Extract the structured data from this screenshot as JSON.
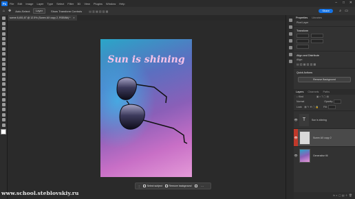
{
  "app": {
    "menu": [
      "File",
      "Edit",
      "Image",
      "Layer",
      "Type",
      "Select",
      "Filter",
      "3D",
      "View",
      "Plugins",
      "Window",
      "Help"
    ],
    "window_controls": [
      "–",
      "□",
      "✕"
    ]
  },
  "options_bar": {
    "auto_select": "Auto-Select:",
    "layer": "Layer",
    "show_transform": "Show Transform Controls",
    "share": "Share"
  },
  "document_tab": {
    "label": "scene 8,451,67 @ 12.5% (Sunex AX copy 2, RGB/8#) *",
    "close": "×"
  },
  "canvas": {
    "headline": "Sun is shining",
    "colors": {
      "top": "#2aa6c8",
      "mid": "#8a5fb8",
      "bottom": "#e49ad8",
      "headline": "#f6c3e8"
    }
  },
  "taskbar": {
    "select_subject": "Select subject",
    "remove_background": "Remove background"
  },
  "watermark": "www.school.steblovskiy.ru",
  "properties_panel": {
    "tabs": [
      "Properties",
      "Libraries"
    ],
    "pixel_layer": "Pixel Layer",
    "transform_title": "Transform",
    "align_title": "Align and Distribute",
    "align_sub": "Align:",
    "quick_actions_title": "Quick Actions",
    "remove_bg_button": "Remove Background"
  },
  "layers_panel": {
    "tabs": [
      "Layers",
      "Channels",
      "Paths"
    ],
    "kind": "Kind",
    "blend_mode": "Normal",
    "opacity_label": "Opacity:",
    "lock_label": "Lock:",
    "fill_label": "Fill:",
    "layers": [
      {
        "name": "Sun is shining",
        "type": "text",
        "visible": true,
        "selected": false
      },
      {
        "name": "Sunex AX copy 2",
        "type": "pixel",
        "visible": true,
        "selected": true
      },
      {
        "name": "Generative fill",
        "type": "gradient",
        "visible": true,
        "selected": false
      }
    ]
  },
  "accent": "#1473e6"
}
